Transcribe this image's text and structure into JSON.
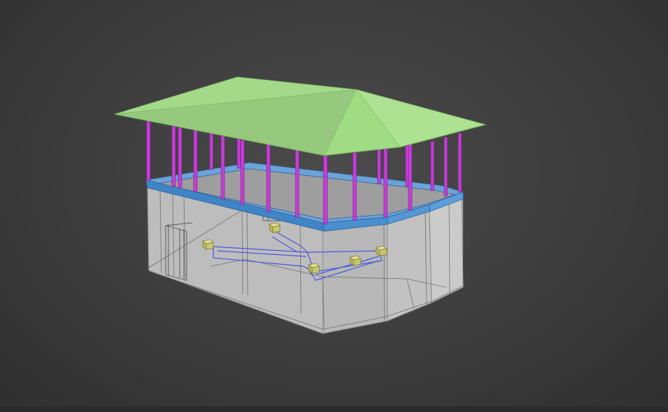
{
  "viewport": {
    "view": "perspective",
    "shading": "edged-faces",
    "background_color": "#3f3f3f",
    "selection_border_color": "#c7882c"
  },
  "model": {
    "objects": [
      {
        "name": "roof",
        "color": "#a8e08a"
      },
      {
        "name": "columns",
        "count": 20,
        "color": "#c23fd4"
      },
      {
        "name": "floor-slab",
        "color": "#3f85c6"
      },
      {
        "name": "walls",
        "color": "#c5c5c5"
      },
      {
        "name": "stairs",
        "color": "#4a55e0"
      },
      {
        "name": "light-helpers",
        "count": 5,
        "color": "#c8c878"
      }
    ]
  }
}
